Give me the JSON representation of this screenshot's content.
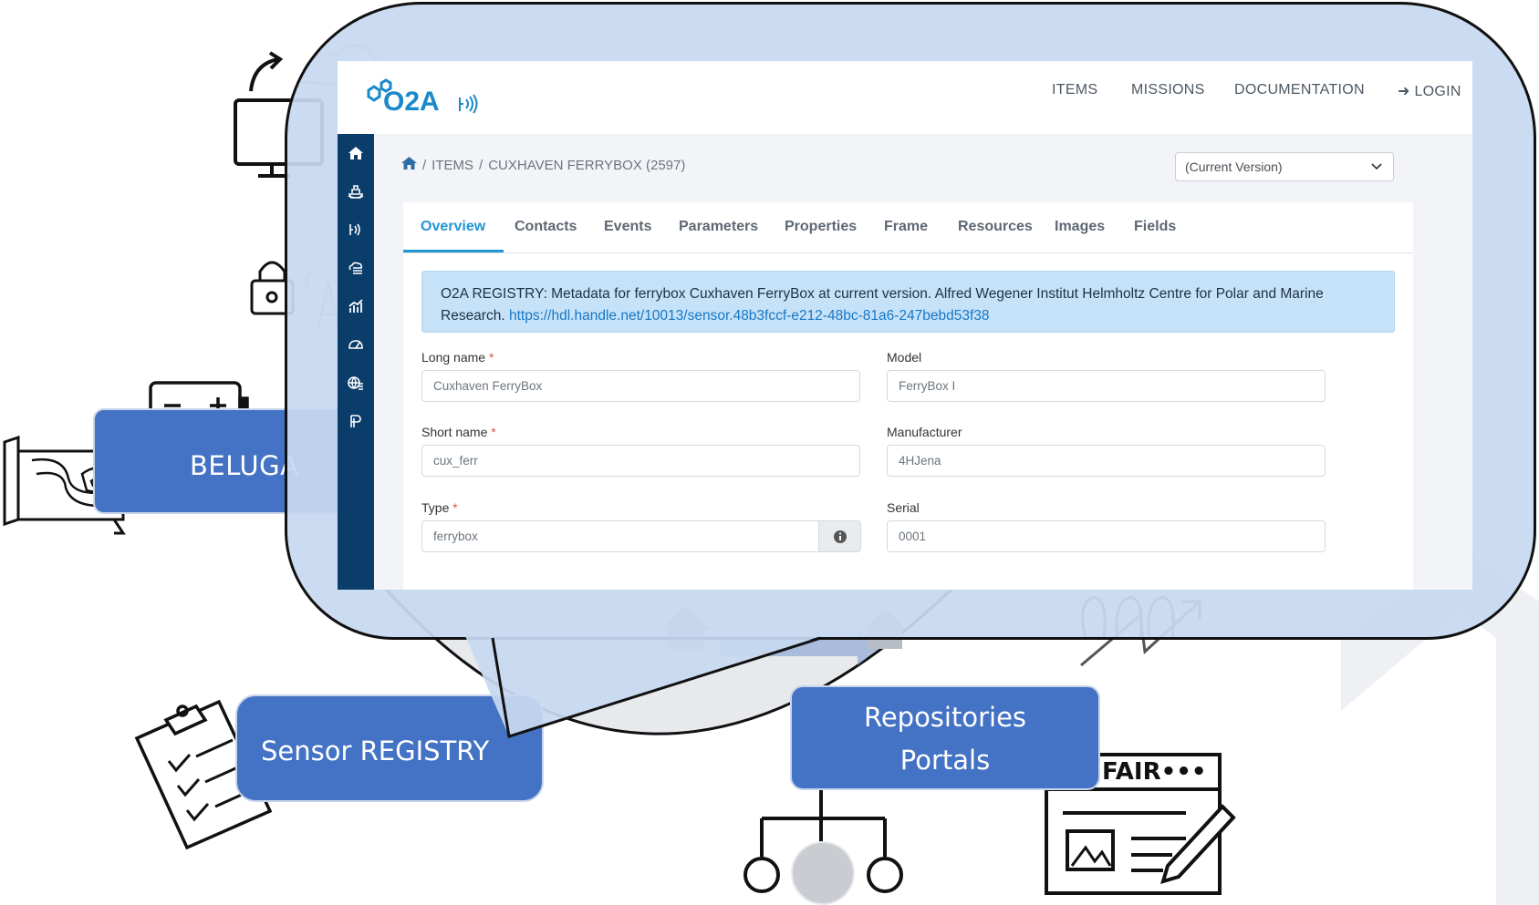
{
  "illustration": {
    "beluga_label": "BELUGA",
    "registry_label": "Sensor REGISTRY",
    "repositories_line1": "Repositories",
    "repositories_line2": "Portals",
    "fair_label": "FAIR•••"
  },
  "app": {
    "logo_text": "O2A",
    "nav": {
      "items": "ITEMS",
      "missions": "MISSIONS",
      "documentation": "DOCUMENTATION",
      "login": "LOGIN"
    },
    "sidebar_icons": [
      "home-icon",
      "vessel-icon",
      "sensor-icon",
      "cloud-stack-icon",
      "chart-icon",
      "dashboard-icon",
      "globe-stack-icon",
      "parameter-icon"
    ],
    "breadcrumb": {
      "sep1": "/",
      "items": "ITEMS",
      "sep2": "/",
      "current": "CUXHAVEN FERRYBOX (2597)"
    },
    "version_select": "(Current Version)",
    "tabs": [
      "Overview",
      "Contacts",
      "Events",
      "Parameters",
      "Properties",
      "Frame",
      "Resources",
      "Images",
      "Fields"
    ],
    "alert": {
      "text": "O2A REGISTRY: Metadata for ferrybox Cuxhaven FerryBox at current version. Alfred Wegener Institut Helmholtz Centre for Polar and Marine Research.",
      "link": "https://hdl.handle.net/10013/sensor.48b3fccf-e212-48bc-81a6-247bebd53f38"
    },
    "form": {
      "long_name": {
        "label": "Long name",
        "value": "Cuxhaven FerryBox"
      },
      "short_name": {
        "label": "Short name",
        "value": "cux_ferr"
      },
      "type": {
        "label": "Type",
        "value": "ferrybox"
      },
      "model": {
        "label": "Model",
        "value": "FerryBox I"
      },
      "manufacturer": {
        "label": "Manufacturer",
        "value": "4HJena"
      },
      "serial": {
        "label": "Serial",
        "value": "0001"
      },
      "required_mark": "*"
    },
    "colors": {
      "accent": "#2395d4",
      "sidebar": "#0b3d6b",
      "alert_bg": "#c6e2f8",
      "illustration_blue": "#4472c4"
    }
  }
}
